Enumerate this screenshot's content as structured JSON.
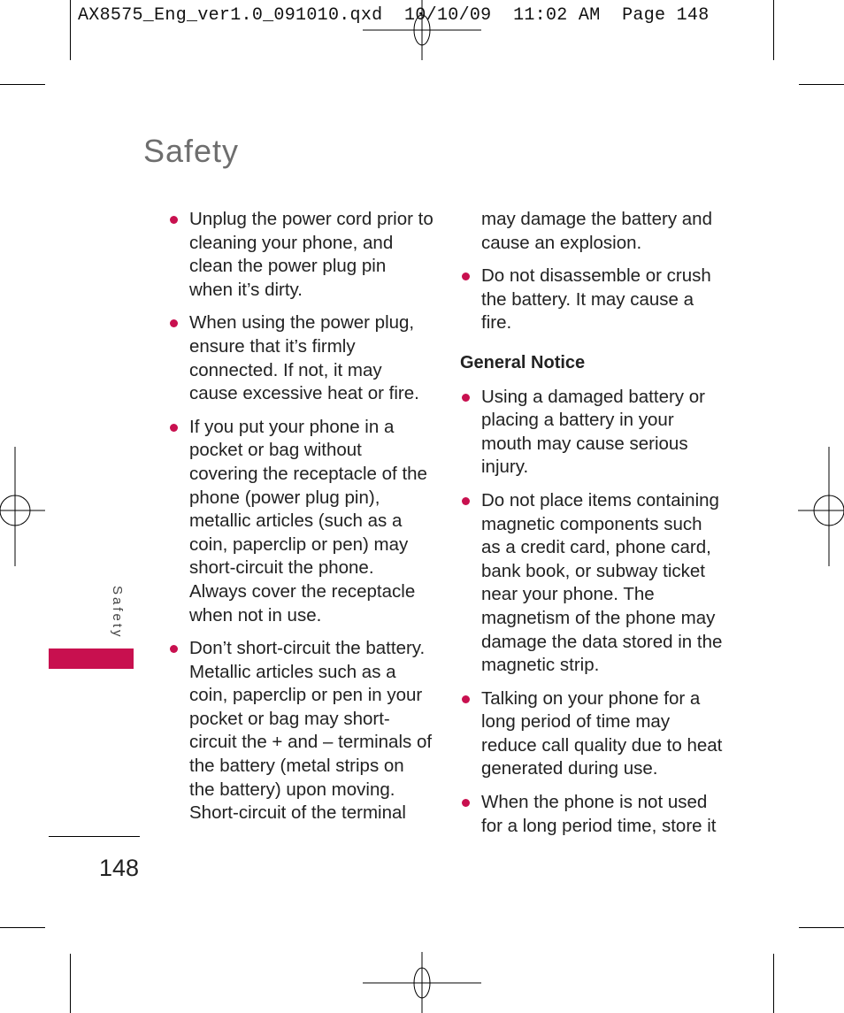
{
  "print_slug": "AX8575_Eng_ver1.0_091010.qxd  10/10/09  11:02 AM  Page 148",
  "page": {
    "title": "Safety",
    "side_tab_label": "Safety",
    "page_number": "148",
    "accent_color": "#c8104f"
  },
  "left_column": {
    "bullets": [
      "Unplug the power cord prior to cleaning your phone, and clean the power plug pin when it’s dirty.",
      "When using the power plug, ensure that it’s firmly connected. If not, it may cause excessive heat or fire.",
      "If you put your phone in a pocket or bag without covering the receptacle of the phone (power plug pin), metallic articles (such as a coin, paperclip or pen) may short-circuit the phone. Always cover the receptacle when not in use.",
      "Don’t short-circuit the battery. Metallic articles such as a coin, paperclip or pen in your pocket or bag may short-circuit the + and – terminals of the battery (metal strips on the battery) upon moving. Short-circuit of the terminal"
    ]
  },
  "right_column": {
    "continuation": "may damage the battery and cause an explosion.",
    "bullets_before": [
      "Do not disassemble or crush the battery. It may cause a fire."
    ],
    "section_heading": "General Notice",
    "bullets_after": [
      "Using a damaged battery or placing a battery in your mouth may cause serious injury.",
      "Do not place items containing magnetic components such as a credit card, phone card, bank book, or subway ticket near your phone. The magnetism of the phone may damage the data stored in the magnetic strip.",
      "Talking on your phone for a long period of time may reduce call quality due to heat generated during use.",
      "When the phone is not used for a long period time, store it"
    ]
  }
}
